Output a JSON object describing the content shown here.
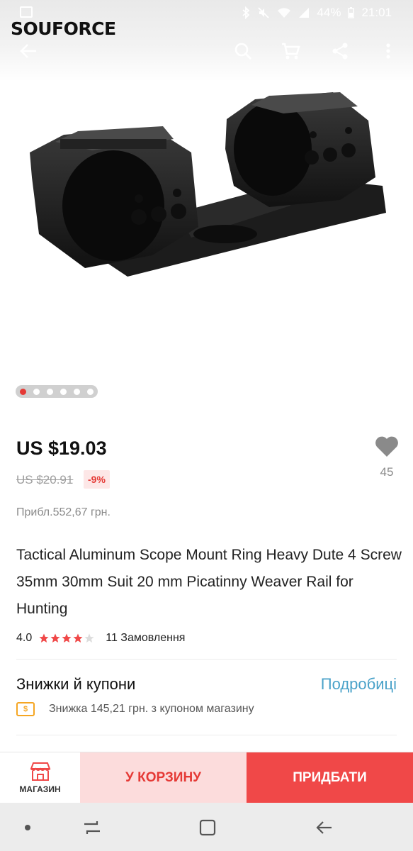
{
  "status_bar": {
    "battery": "44%",
    "time": "21:01"
  },
  "brand": {
    "logo_text": "SOUFORCE"
  },
  "carousel": {
    "total": 6,
    "active_index": 0
  },
  "product": {
    "price": "US $19.03",
    "old_price": "US $20.91",
    "discount": "-9%",
    "approx_price": "Прибл.552,67 грн.",
    "wishlist_count": "45",
    "title": "Tactical Aluminum Scope Mount Ring Heavy Dute 4 Screw 35mm 30mm Suit 20 mm Picatinny Weaver Rail for Hunting",
    "rating": "4.0",
    "stars_filled": 4,
    "stars_total": 5,
    "orders": "11 Замовлення"
  },
  "coupons": {
    "title": "Знижки й купони",
    "details_link": "Подробиці",
    "icon_text": "$",
    "description": "Знижка 145,21 грн. з купоном магазину"
  },
  "action_bar": {
    "store_label": "МАГАЗИН",
    "cart_label": "У КОРЗИНУ",
    "buy_label": "ПРИДБАТИ"
  },
  "colors": {
    "accent_red": "#e53935",
    "buy_button": "#f04848",
    "cart_button_bg": "#fcdcdc",
    "link_blue": "#4aa2c9",
    "coupon_orange": "#f5a623"
  }
}
